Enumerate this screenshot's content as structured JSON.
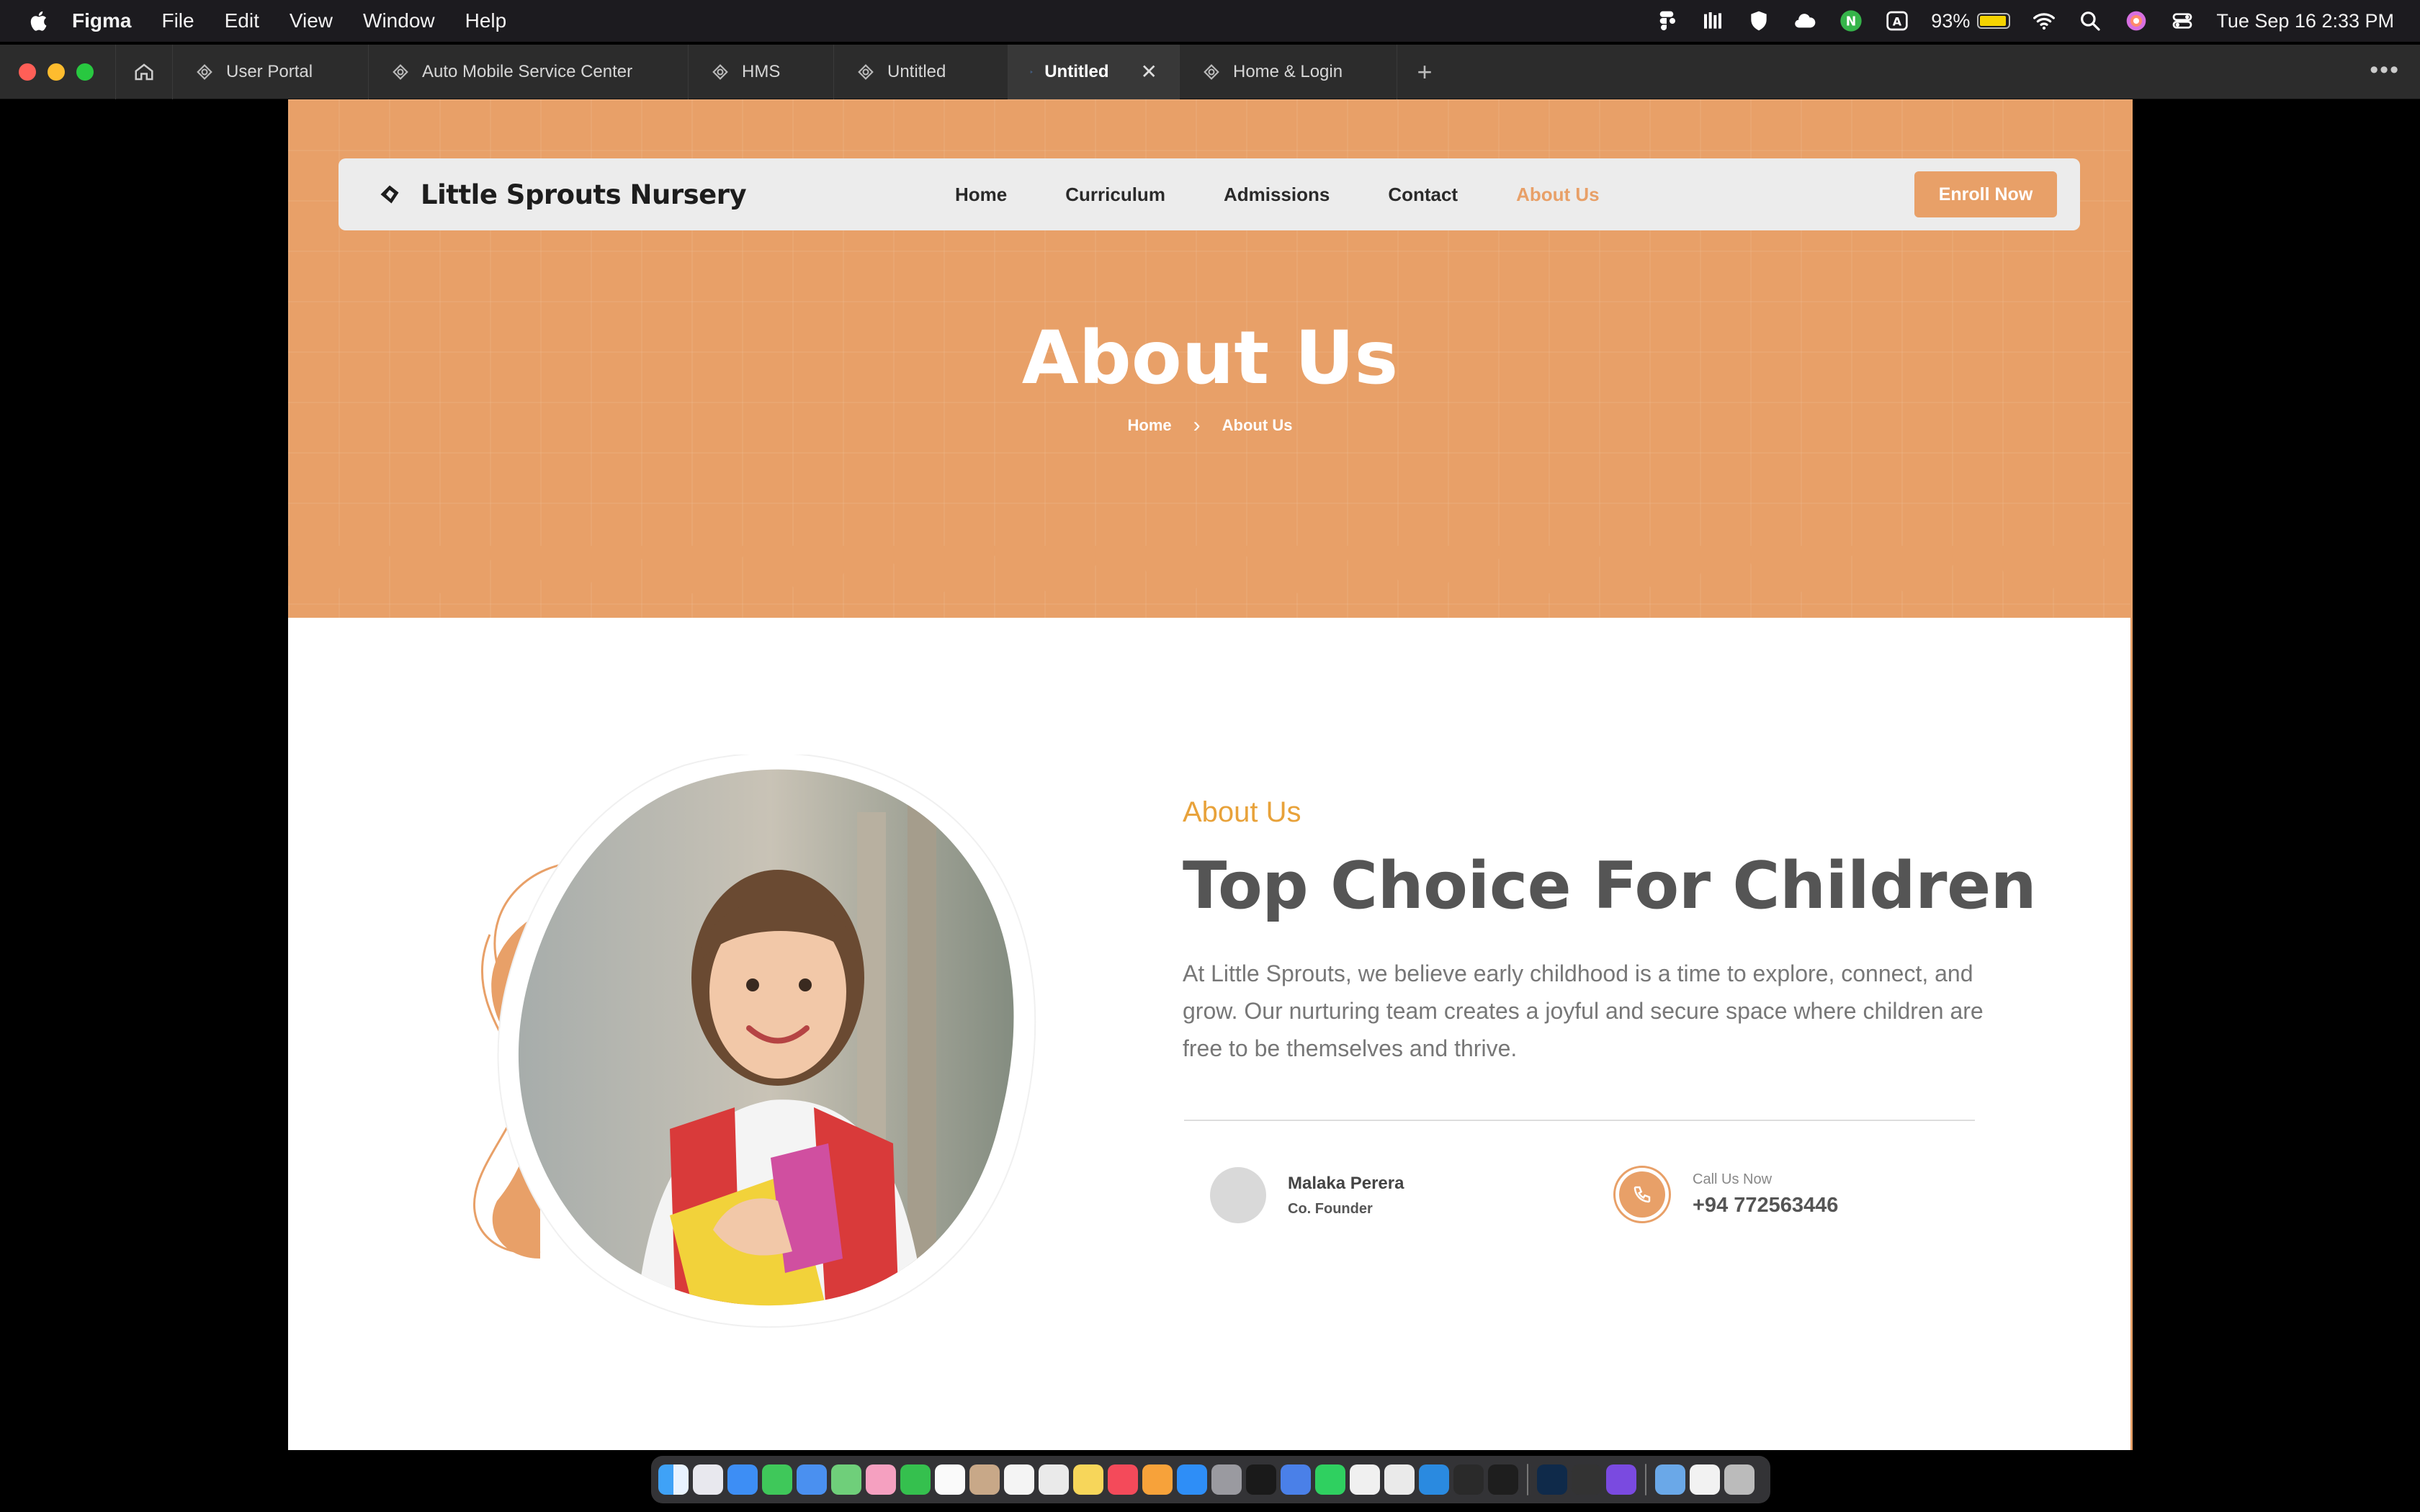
{
  "menubar": {
    "app": "Figma",
    "items": [
      "File",
      "Edit",
      "View",
      "Window",
      "Help"
    ],
    "battery": "93%",
    "datetime": "Tue Sep 16  2:33 PM"
  },
  "tabs": [
    {
      "label": "User Portal"
    },
    {
      "label": "Auto Mobile Service Center"
    },
    {
      "label": "HMS"
    },
    {
      "label": "Untitled"
    },
    {
      "label": "Untitled",
      "active": true
    },
    {
      "label": "Home & Login"
    }
  ],
  "site": {
    "brand": "Little Sprouts Nursery",
    "nav": [
      "Home",
      "Curriculum",
      "Admissions",
      "Contact",
      "About Us"
    ],
    "active_nav": "About Us",
    "cta": "Enroll Now",
    "hero_title": "About Us",
    "breadcrumb": {
      "home": "Home",
      "current": "About Us"
    },
    "kicker": "About Us",
    "headline": "Top Choice For Children",
    "body": "At Little Sprouts, we believe early childhood is a time to explore, connect, and grow. Our nurturing team creates a joyful and secure space where children are free to be themselves and thrive.",
    "founder": {
      "name": "Malaka Perera",
      "role": "Co. Founder"
    },
    "call": {
      "label": "Call Us Now",
      "number": "+94 772563446"
    }
  },
  "colors": {
    "accent": "#e8a068",
    "kicker": "#e8a23a",
    "figma_bg": "#2c2c2c"
  },
  "icons": [
    "apple-icon",
    "home-icon",
    "figma-file-icon",
    "prototype-play-icon",
    "close-icon",
    "plus-icon",
    "more-icon",
    "search-icon",
    "wifi-icon",
    "phone-icon"
  ]
}
